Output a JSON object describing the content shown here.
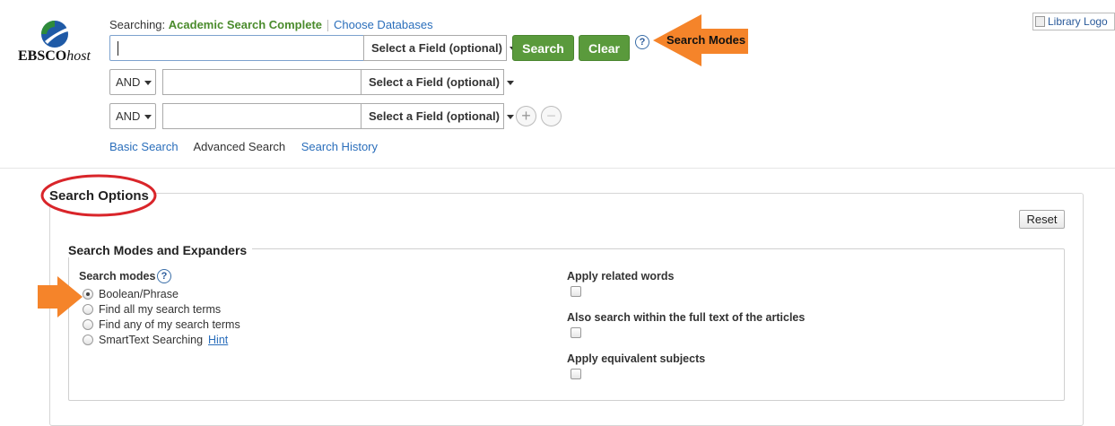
{
  "header": {
    "logo_text": "EBSCO",
    "logo_text_italic": "host",
    "searching_label": "Searching:",
    "database_name": "Academic Search Complete",
    "choose_databases": "Choose Databases",
    "library_logo_alt": "Library Logo"
  },
  "search": {
    "rows": [
      {
        "value": "",
        "field": "Select a Field (optional)"
      },
      {
        "operator": "AND",
        "value": "",
        "field": "Select a Field (optional)"
      },
      {
        "operator": "AND",
        "value": "",
        "field": "Select a Field (optional)"
      }
    ],
    "search_button": "Search",
    "clear_button": "Clear",
    "help": "?",
    "add_row": "+",
    "remove_row": "−"
  },
  "tabs": {
    "basic": "Basic Search",
    "advanced": "Advanced Search",
    "history": "Search History"
  },
  "annotations": {
    "search_modes_arrow": "Search Modes",
    "arrow_color": "#f5842a",
    "circle_color": "#d9252a"
  },
  "options": {
    "title": "Search Options",
    "reset": "Reset",
    "section_title": "Search Modes and Expanders",
    "search_modes_label": "Search modes",
    "help": "?",
    "modes": [
      {
        "label": "Boolean/Phrase",
        "checked": true
      },
      {
        "label": "Find all my search terms",
        "checked": false
      },
      {
        "label": "Find any of my search terms",
        "checked": false
      },
      {
        "label": "SmartText Searching",
        "checked": false
      }
    ],
    "hint": "Hint",
    "expanders": [
      {
        "label": "Apply related words",
        "checked": false
      },
      {
        "label": "Also search within the full text of the articles",
        "checked": false
      },
      {
        "label": "Apply equivalent subjects",
        "checked": false
      }
    ]
  },
  "colors": {
    "accent_green": "#5a9a3c",
    "link_blue": "#2a6ebb"
  }
}
